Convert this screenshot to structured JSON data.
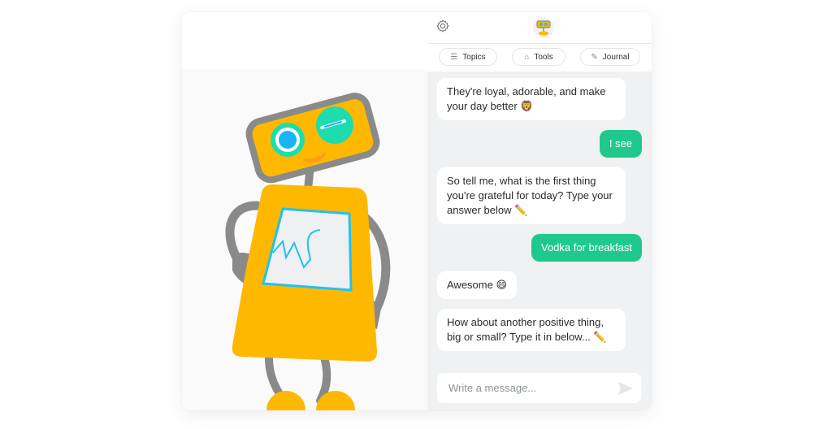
{
  "header": {
    "settings_icon": "gear-icon",
    "logo_icon": "robot-logo-icon"
  },
  "tabs": [
    {
      "label": "Topics",
      "icon": "list-icon",
      "glyph": "☰"
    },
    {
      "label": "Tools",
      "icon": "toolbox-icon",
      "glyph": "⌂"
    },
    {
      "label": "Journal",
      "icon": "edit-icon",
      "glyph": "✎"
    }
  ],
  "messages": [
    {
      "sender": "bot",
      "text": "They're loyal, adorable, and make your day better 🦁"
    },
    {
      "sender": "user",
      "text": "I see"
    },
    {
      "sender": "bot",
      "text": "So tell me, what is the first thing you're grateful for today? Type your answer below ✏️"
    },
    {
      "sender": "user",
      "text": "Vodka for breakfast"
    },
    {
      "sender": "bot",
      "text": "Awesome 😄"
    },
    {
      "sender": "bot",
      "text": "How about another positive thing, big or small? Type it in below... ✏️"
    }
  ],
  "composer": {
    "placeholder": "Write a message...",
    "value": "",
    "send_icon": "send-icon"
  },
  "colors": {
    "accent": "#1fc98e",
    "robot_body": "#ffb800",
    "robot_limbs": "#8a8a8a",
    "robot_screen_border": "#1fc2f0",
    "robot_eye": "#1fdcae",
    "chat_background": "#f0f1f3"
  }
}
